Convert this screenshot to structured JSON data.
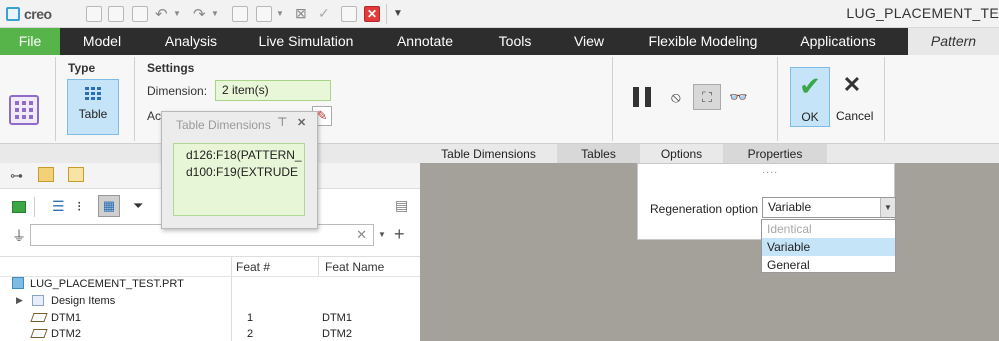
{
  "app": {
    "logo_text": "creo",
    "window_title": "LUG_PLACEMENT_TE"
  },
  "quick_access": {
    "close_glyph": "✕",
    "menu_glyph": "▼"
  },
  "ribbon_tabs": [
    {
      "label": "File"
    },
    {
      "label": "Model"
    },
    {
      "label": "Analysis"
    },
    {
      "label": "Live Simulation"
    },
    {
      "label": "Annotate"
    },
    {
      "label": "Tools"
    },
    {
      "label": "View"
    },
    {
      "label": "Flexible Modeling"
    },
    {
      "label": "Applications"
    },
    {
      "label": "Pattern"
    }
  ],
  "ribbon": {
    "type_header": "Type",
    "table_button_label": "Table",
    "settings_header": "Settings",
    "dimension_label": "Dimension:",
    "dimension_value": "2 item(s)",
    "active_label_partial": "Ac",
    "ok_label": "OK",
    "cancel_label": "Cancel"
  },
  "table_dimensions_dialog": {
    "title": "Table Dimensions",
    "items": [
      "d126:F18(PATTERN_",
      "d100:F19(EXTRUDE"
    ]
  },
  "panel_tabs": [
    {
      "label": "Table Dimensions"
    },
    {
      "label": "Tables"
    },
    {
      "label": "Options"
    },
    {
      "label": "Properties"
    }
  ],
  "options_panel": {
    "grip": "....",
    "regeneration_label": "Regeneration option",
    "regeneration_value": "Variable",
    "dropdown_options": [
      {
        "label": "Identical",
        "state": "disabled"
      },
      {
        "label": "Variable",
        "state": "selected"
      },
      {
        "label": "General",
        "state": "normal"
      }
    ]
  },
  "model_tree": {
    "columns": [
      "Feat #",
      "Feat Name"
    ],
    "root": "LUG_PLACEMENT_TEST.PRT",
    "rows": [
      {
        "name": "Design Items",
        "feat_num": "",
        "feat_name": ""
      },
      {
        "name": "DTM1",
        "feat_num": "1",
        "feat_name": "DTM1"
      },
      {
        "name": "DTM2",
        "feat_num": "2",
        "feat_name": "DTM2"
      }
    ]
  },
  "colors": {
    "file_tab": "#56b44a",
    "ribbon_dark": "#2d2d2d",
    "selection_blue": "#c5e4f7",
    "input_green": "#e8f7d8",
    "graphics_bg": "#a4a09a",
    "ok_check": "#3aa646"
  }
}
